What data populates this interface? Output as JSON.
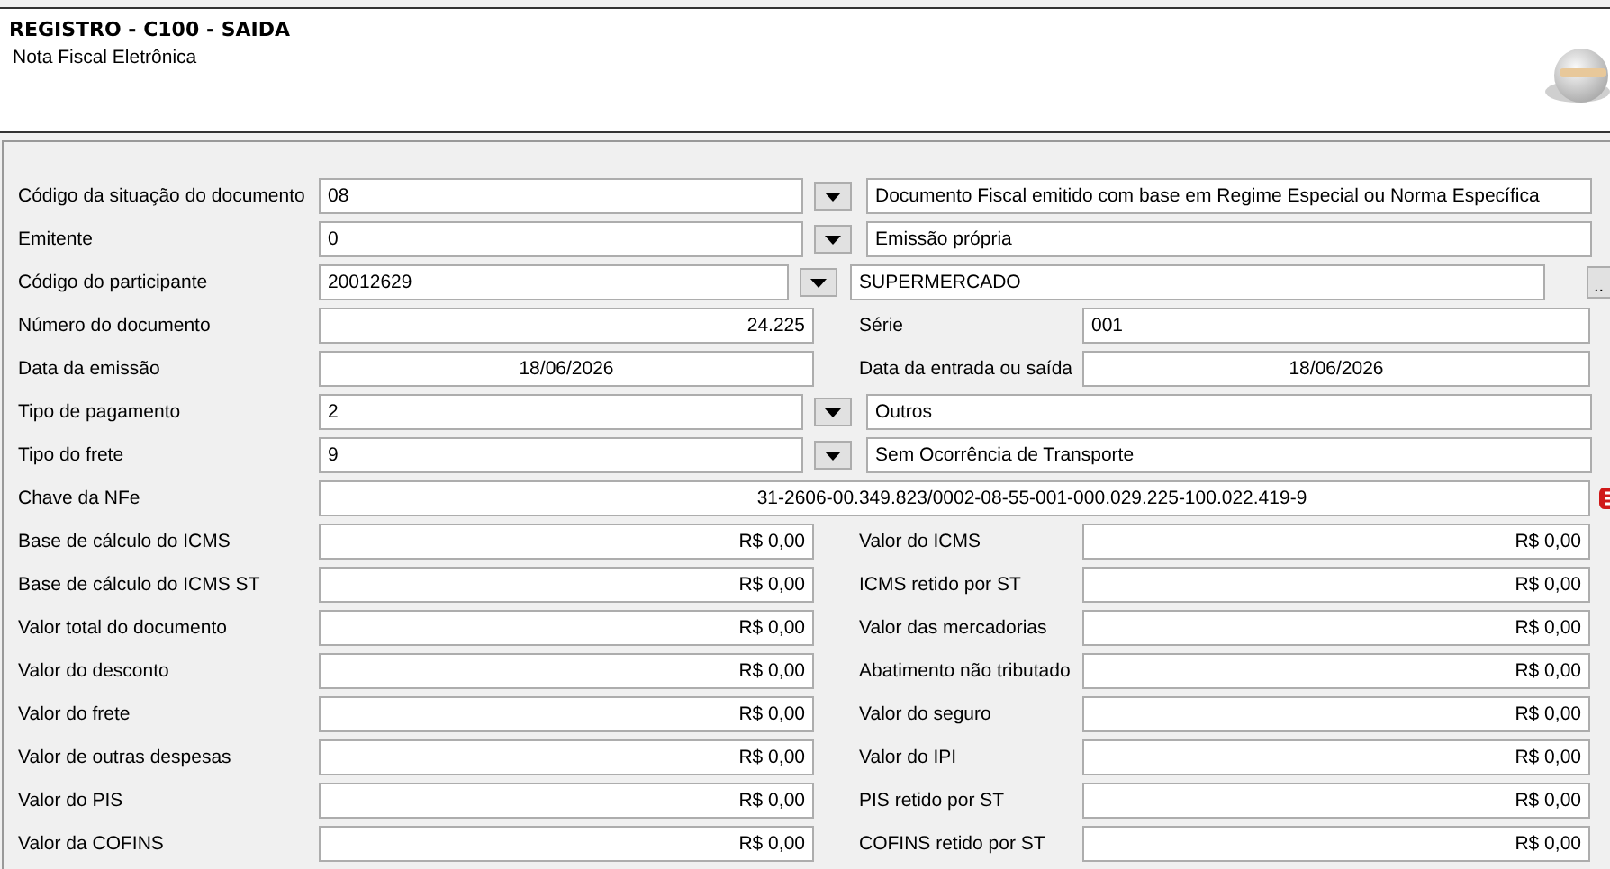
{
  "header": {
    "title": "REGISTRO - C100 - SAIDA",
    "subtitle": "Nota Fiscal Eletrônica"
  },
  "rows": [
    {
      "kind": "combo",
      "label": "Código da situação do documento",
      "value": "08",
      "description": "Documento Fiscal emitido com base em Regime Especial ou Norma Específica"
    },
    {
      "kind": "combo",
      "label": "Emitente",
      "value": "0",
      "description": "Emissão própria"
    },
    {
      "kind": "lookup",
      "label": "Código do participante",
      "value": "20012629",
      "description": "SUPERMERCADO",
      "button": ".."
    },
    {
      "kind": "pair",
      "left": {
        "label": "Número do documento",
        "value": "24.225",
        "kind": "number"
      },
      "right": {
        "label": "Série",
        "value": "001",
        "kind": "text"
      }
    },
    {
      "kind": "pair",
      "left": {
        "label": "Data da emissão",
        "value": "18/06/2026",
        "kind": "date"
      },
      "right": {
        "label": "Data da entrada ou saída",
        "value": "18/06/2026",
        "kind": "date"
      }
    },
    {
      "kind": "combo",
      "label": "Tipo de pagamento",
      "value": "2",
      "description": "Outros"
    },
    {
      "kind": "combo",
      "label": "Tipo do frete",
      "value": "9",
      "description": "Sem Ocorrência de Transporte"
    },
    {
      "kind": "wide",
      "label": "Chave da NFe",
      "value": "31-2606-00.349.823/0002-08-55-001-000.029.225-100.022.419-9",
      "error": true
    },
    {
      "kind": "pair",
      "left": {
        "label": "Base de cálculo do ICMS",
        "value": "R$ 0,00",
        "kind": "number"
      },
      "right": {
        "label": "Valor do ICMS",
        "value": "R$ 0,00",
        "kind": "number"
      }
    },
    {
      "kind": "pair",
      "left": {
        "label": "Base de cálculo do ICMS ST",
        "value": "R$ 0,00",
        "kind": "number"
      },
      "right": {
        "label": "ICMS retido por ST",
        "value": "R$ 0,00",
        "kind": "number"
      }
    },
    {
      "kind": "pair",
      "left": {
        "label": "Valor total do documento",
        "value": "R$ 0,00",
        "kind": "number"
      },
      "right": {
        "label": "Valor das mercadorias",
        "value": "R$ 0,00",
        "kind": "number"
      }
    },
    {
      "kind": "pair",
      "left": {
        "label": "Valor do desconto",
        "value": "R$ 0,00",
        "kind": "number"
      },
      "right": {
        "label": "Abatimento não tributado",
        "value": "R$ 0,00",
        "kind": "number"
      }
    },
    {
      "kind": "pair",
      "left": {
        "label": "Valor do frete",
        "value": "R$ 0,00",
        "kind": "number"
      },
      "right": {
        "label": "Valor do seguro",
        "value": "R$ 0,00",
        "kind": "number"
      }
    },
    {
      "kind": "pair",
      "left": {
        "label": "Valor de outras despesas",
        "value": "R$ 0,00",
        "kind": "number"
      },
      "right": {
        "label": "Valor do IPI",
        "value": "R$ 0,00",
        "kind": "number"
      }
    },
    {
      "kind": "pair",
      "left": {
        "label": "Valor do PIS",
        "value": "R$ 0,00",
        "kind": "number"
      },
      "right": {
        "label": "PIS retido por ST",
        "value": "R$ 0,00",
        "kind": "number"
      }
    },
    {
      "kind": "pair",
      "left": {
        "label": "Valor da COFINS",
        "value": "R$ 0,00",
        "kind": "number"
      },
      "right": {
        "label": "COFINS retido por ST",
        "value": "R$ 0,00",
        "kind": "number"
      }
    }
  ]
}
